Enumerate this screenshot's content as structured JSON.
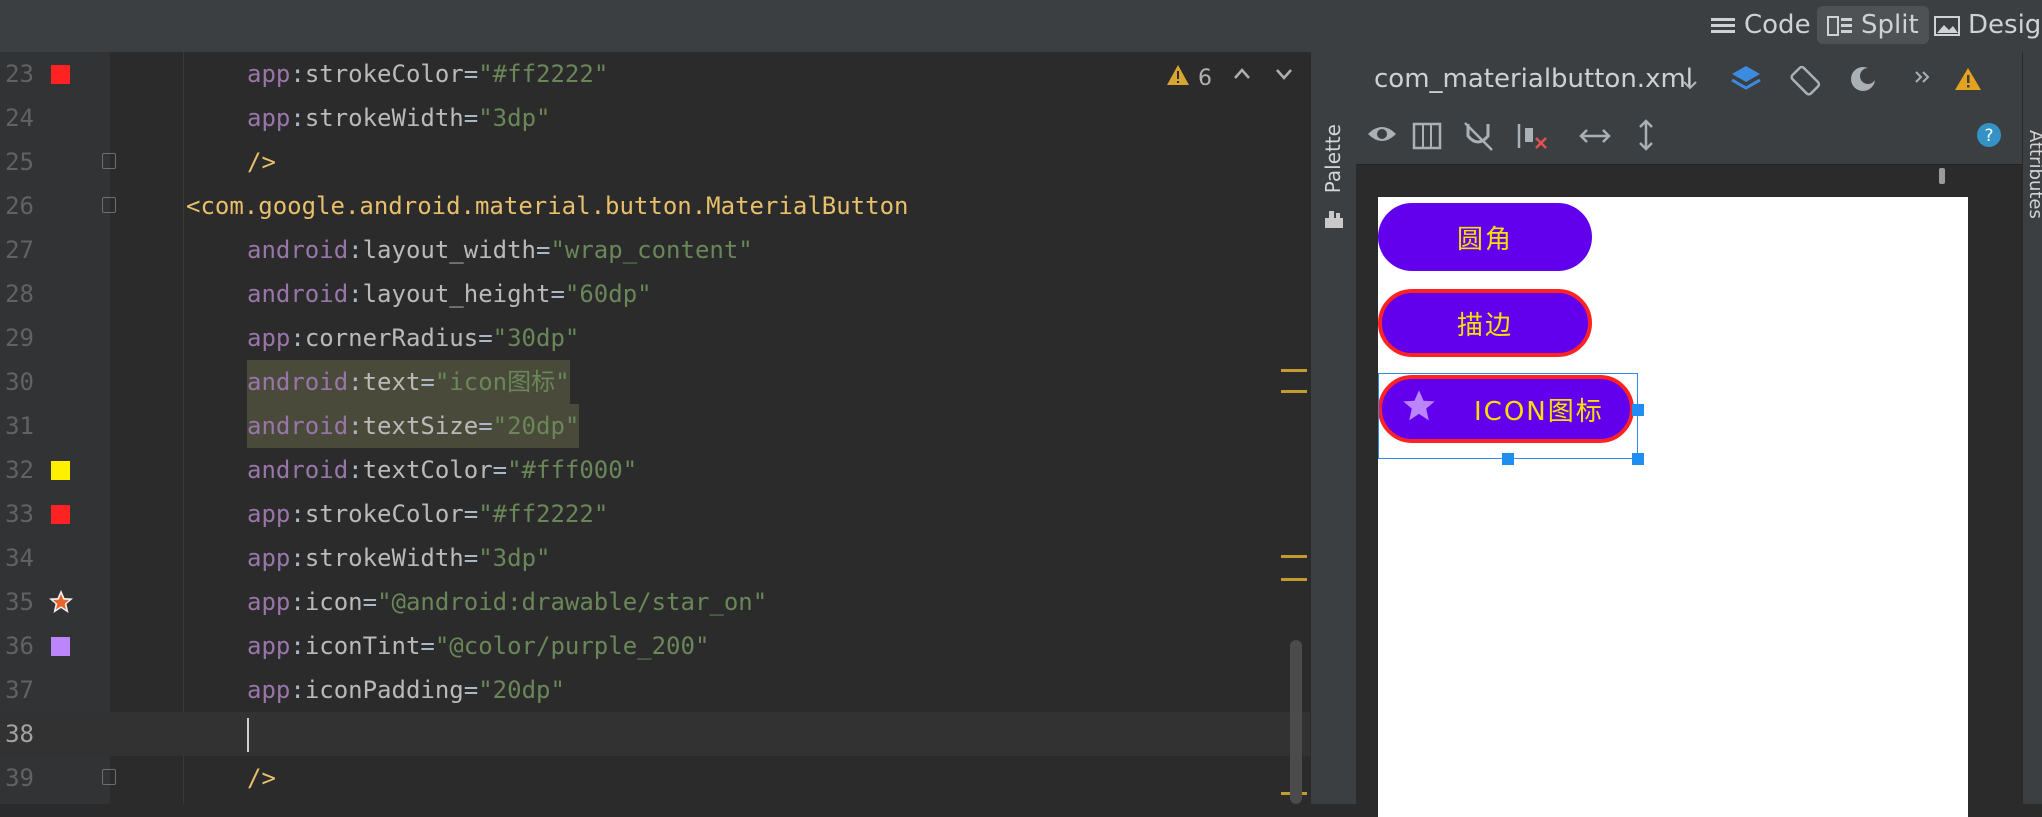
{
  "toolbar": {
    "views": [
      {
        "label": "Code",
        "icon": "hamburger-lines-icon"
      },
      {
        "label": "Split",
        "icon": "split-view-icon",
        "active": true
      },
      {
        "label": "Design",
        "icon": "image-icon"
      }
    ]
  },
  "editor": {
    "warnings_count": "6",
    "lines": [
      {
        "num": "23",
        "marker": "#ff2222"
      },
      {
        "num": "24"
      },
      {
        "num": "25"
      },
      {
        "num": "26"
      },
      {
        "num": "27"
      },
      {
        "num": "28"
      },
      {
        "num": "29"
      },
      {
        "num": "30"
      },
      {
        "num": "31"
      },
      {
        "num": "32",
        "marker": "#fff000"
      },
      {
        "num": "33",
        "marker": "#ff2222"
      },
      {
        "num": "34"
      },
      {
        "num": "35",
        "marker": "star-icon"
      },
      {
        "num": "36",
        "marker": "#bb86fc"
      },
      {
        "num": "37"
      },
      {
        "num": "38"
      },
      {
        "num": "39"
      }
    ],
    "code": {
      "l23": {
        "ns": "app",
        "attr": "strokeColor",
        "val": "\"#ff2222\""
      },
      "l24": {
        "ns": "app",
        "attr": "strokeWidth",
        "val": "\"3dp\""
      },
      "l25": "/>",
      "l26": "<com.google.android.material.button.MaterialButton",
      "l27": {
        "ns": "android",
        "attr": "layout_width",
        "val": "\"wrap_content\""
      },
      "l28": {
        "ns": "android",
        "attr": "layout_height",
        "val": "\"60dp\""
      },
      "l29": {
        "ns": "app",
        "attr": "cornerRadius",
        "val": "\"30dp\""
      },
      "l30": {
        "ns": "android",
        "attr": "text",
        "val": "\"icon图标\""
      },
      "l31": {
        "ns": "android",
        "attr": "textSize",
        "val": "\"20dp\""
      },
      "l32": {
        "ns": "android",
        "attr": "textColor",
        "val": "\"#fff000\""
      },
      "l33": {
        "ns": "app",
        "attr": "strokeColor",
        "val": "\"#ff2222\""
      },
      "l34": {
        "ns": "app",
        "attr": "strokeWidth",
        "val": "\"3dp\""
      },
      "l35": {
        "ns": "app",
        "attr": "icon",
        "val": "\"@android:drawable/star_on\""
      },
      "l36": {
        "ns": "app",
        "attr": "iconTint",
        "val": "\"@color/purple_200\""
      },
      "l37": {
        "ns": "app",
        "attr": "iconPadding",
        "val": "\"20dp\""
      },
      "l39": "/>"
    }
  },
  "palette": {
    "label": "Palette"
  },
  "design": {
    "file_name": "com_materialbutton.xml",
    "buttons": [
      {
        "label": "圆角"
      },
      {
        "label": "描边"
      },
      {
        "label": "ICON图标"
      }
    ],
    "colors": {
      "button_bg": "#6200ee",
      "text": "#fff000",
      "stroke": "#ff2222",
      "icon_tint": "#bb86fc"
    }
  },
  "attributes": {
    "label": "Attributes"
  }
}
